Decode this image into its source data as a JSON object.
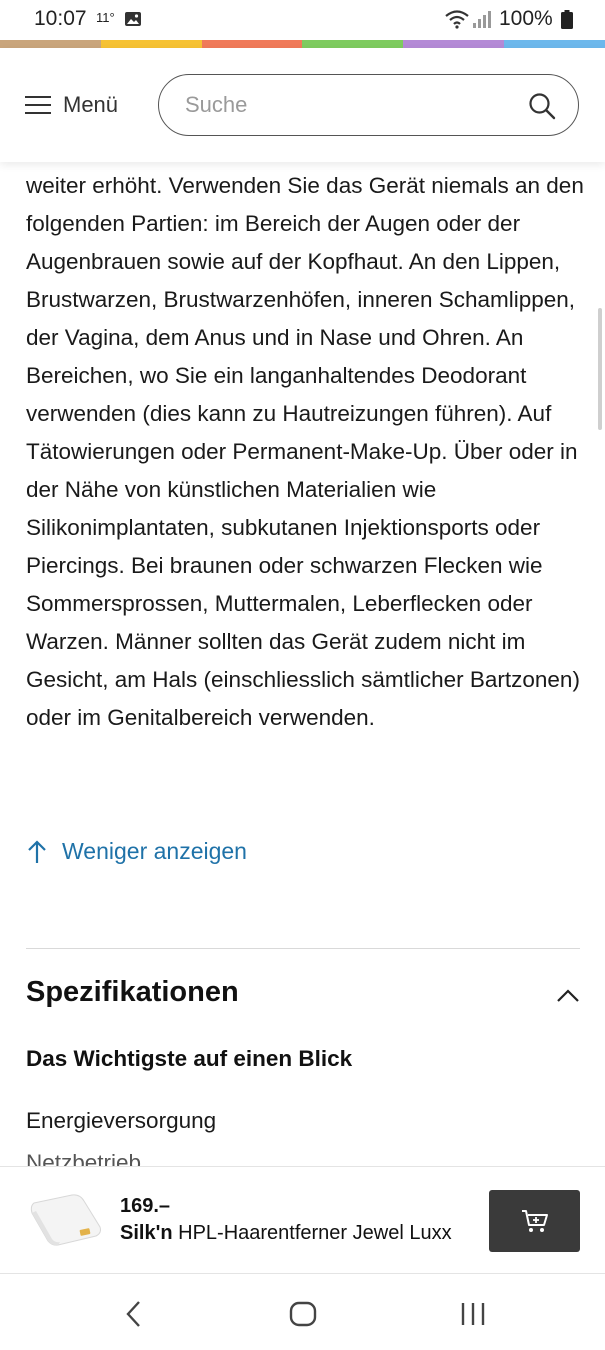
{
  "status_bar": {
    "time": "10:07",
    "temperature": "11°",
    "battery": "100%"
  },
  "brand_strip_colors": [
    "#c9a57c",
    "#f6c234",
    "#f07a5a",
    "#7ecb5f",
    "#b48ad6",
    "#6db8ec"
  ],
  "header": {
    "menu_label": "Menü",
    "search_placeholder": "Suche"
  },
  "description": {
    "text": "weiter erhöht. Verwenden Sie das Gerät niemals an den folgenden Partien: im Bereich der Augen oder der Augenbrauen sowie auf der Kopfhaut. An den Lippen, Brustwarzen, Brustwarzenhöfen, inneren Schamlippen, der Vagina, dem Anus und in Nase und Ohren. An Bereichen, wo Sie ein langanhaltendes Deodorant verwenden (dies kann zu Hautreizungen führen). Auf Tätowierungen oder Permanent-Make-Up. Über oder in der Nähe von künstlichen Materialien wie Silikonimplantaten, subkutanen Injektionsports oder Piercings. Bei braunen oder schwarzen Flecken wie Sommersprossen, Muttermalen, Leberflecken oder Warzen. Männer sollten das Gerät zudem nicht im Gesicht, am Hals (einschliesslich sämtlicher Bartzonen) oder im Genitalbereich verwenden.",
    "show_less_label": "Weniger anzeigen"
  },
  "specifications": {
    "title": "Spezifikationen",
    "subtitle": "Das Wichtigste auf einen Blick",
    "rows": [
      {
        "label": "Energieversorgung",
        "value": "Netzbetrieb"
      }
    ]
  },
  "product_bar": {
    "price": "169.–",
    "brand": "Silk'n",
    "name": "HPL-Haarentferner Jewel Luxx"
  },
  "colors": {
    "accent_link": "#1f72a8",
    "cart_button": "#3a3a3a"
  }
}
